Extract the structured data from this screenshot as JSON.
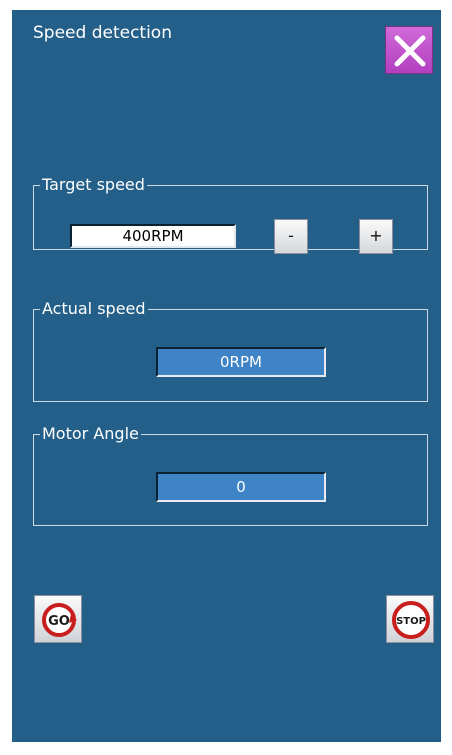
{
  "header": {
    "title": "Speed detection",
    "close_icon": "close-x-icon"
  },
  "target_speed": {
    "label": "Target speed",
    "value": "400RPM",
    "decrement_label": "-",
    "increment_label": "+"
  },
  "actual_speed": {
    "label": "Actual speed",
    "value": "0RPM"
  },
  "motor_angle": {
    "label": "Motor Angle",
    "value": "0"
  },
  "controls": {
    "go_label": "GO",
    "stop_label": "STOP"
  },
  "colors": {
    "background": "#235f88",
    "field_readonly": "#3f84c6",
    "close_button": "#c552cf",
    "stop_red": "#cc1f1f"
  }
}
